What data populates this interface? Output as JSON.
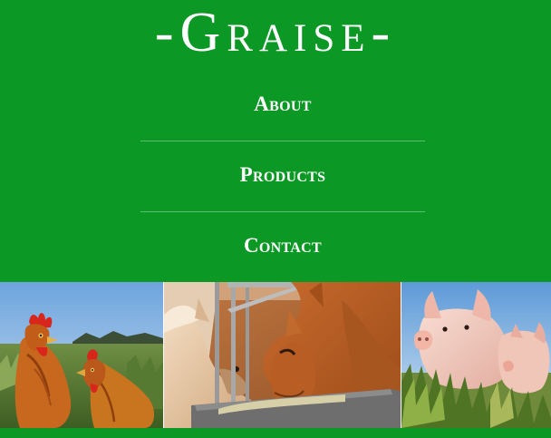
{
  "brand": {
    "logo_text": "-Graise-"
  },
  "nav": {
    "items": [
      {
        "label": "About"
      },
      {
        "label": "Products"
      },
      {
        "label": "Contact"
      }
    ]
  },
  "colors": {
    "background": "#0b9824",
    "text": "#ffffff"
  },
  "photos": [
    {
      "subject": "chickens-icon"
    },
    {
      "subject": "horses-icon"
    },
    {
      "subject": "pigs-icon"
    }
  ]
}
